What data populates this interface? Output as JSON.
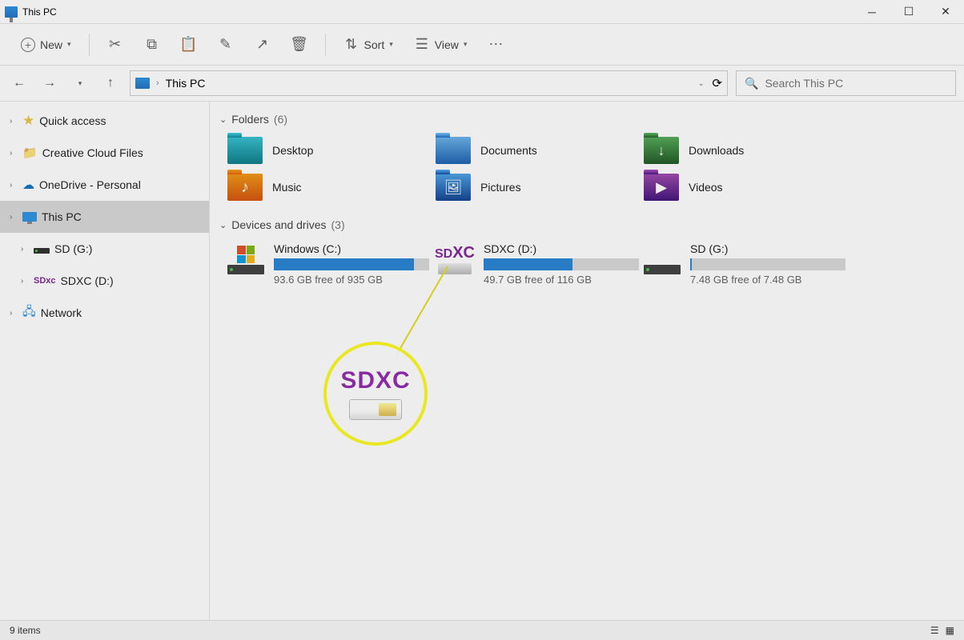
{
  "window": {
    "title": "This PC"
  },
  "toolbar": {
    "new_label": "New",
    "sort_label": "Sort",
    "view_label": "View"
  },
  "address": {
    "path": "This PC",
    "search_placeholder": "Search This PC"
  },
  "sidebar": {
    "items": [
      {
        "label": "Quick access",
        "kind": "star"
      },
      {
        "label": "Creative Cloud Files",
        "kind": "cc"
      },
      {
        "label": "OneDrive - Personal",
        "kind": "cloud"
      },
      {
        "label": "This PC",
        "kind": "monitor",
        "selected": true
      },
      {
        "label": "SD (G:)",
        "kind": "drive"
      },
      {
        "label": "SDXC (D:)",
        "kind": "sdxc"
      },
      {
        "label": "Network",
        "kind": "network"
      }
    ]
  },
  "groups": {
    "folders": {
      "header": "Folders",
      "count": "(6)",
      "items": [
        {
          "label": "Desktop",
          "icon": "teal"
        },
        {
          "label": "Documents",
          "icon": "blue"
        },
        {
          "label": "Downloads",
          "icon": "green"
        },
        {
          "label": "Music",
          "icon": "orange"
        },
        {
          "label": "Pictures",
          "icon": "blue2"
        },
        {
          "label": "Videos",
          "icon": "purple"
        }
      ]
    },
    "drives": {
      "header": "Devices and drives",
      "count": "(3)",
      "items": [
        {
          "name": "Windows (C:)",
          "free": "93.6 GB free of 935 GB",
          "fill_pct": 90,
          "icon": "win-hdd"
        },
        {
          "name": "SDXC (D:)",
          "free": "49.7 GB free of 116 GB",
          "fill_pct": 57,
          "icon": "sdxc-card"
        },
        {
          "name": "SD (G:)",
          "free": "7.48 GB free of 7.48 GB",
          "fill_pct": 1,
          "icon": "hdd"
        }
      ]
    }
  },
  "status": {
    "items_label": "9 items"
  },
  "callout": {
    "label": "SDXC"
  }
}
